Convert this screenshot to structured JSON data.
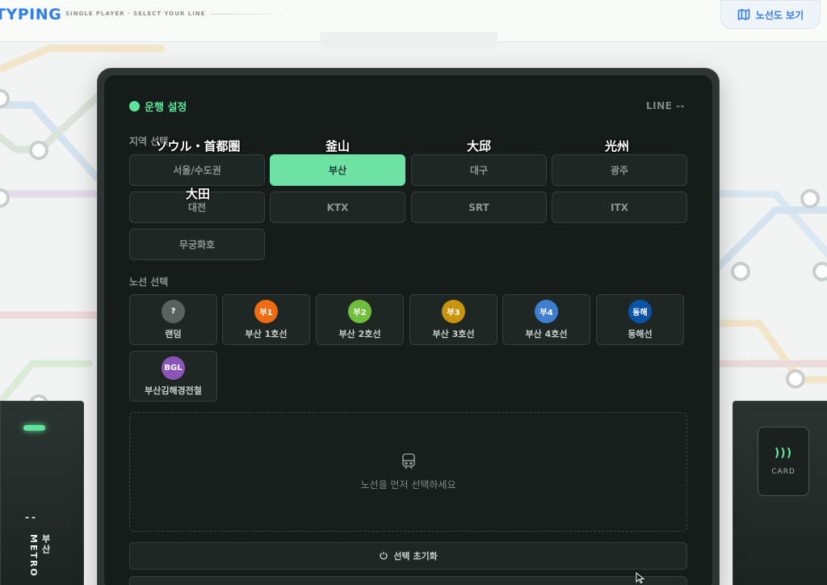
{
  "header": {
    "brand": "TYPING",
    "subtitle": "SINGLE PLAYER · SELECT YOUR LINE",
    "map_button": {
      "label": "노선도 보기",
      "icon": "map-icon"
    }
  },
  "panel": {
    "title": "운행 설정",
    "line_indicator": "LINE --",
    "region_section_label": "지역 선택",
    "regions": [
      {
        "label": "서울/수도권",
        "overlay": "ソウル・首都圏",
        "active": false
      },
      {
        "label": "부산",
        "overlay": "釜山",
        "active": true
      },
      {
        "label": "대구",
        "overlay": "大邱",
        "active": false
      },
      {
        "label": "광주",
        "overlay": "光州",
        "active": false
      },
      {
        "label": "대전",
        "overlay": "大田",
        "active": false
      },
      {
        "label": "KTX",
        "overlay": "",
        "active": false
      },
      {
        "label": "SRT",
        "overlay": "",
        "active": false
      },
      {
        "label": "ITX",
        "overlay": "",
        "active": false
      },
      {
        "label": "무궁화호",
        "overlay": "",
        "active": false
      }
    ],
    "line_section_label": "노선 선택",
    "lines": [
      {
        "badge": "?",
        "name": "랜덤",
        "color": "#5a625f"
      },
      {
        "badge": "부1",
        "name": "부산 1호선",
        "color": "#f06a0f"
      },
      {
        "badge": "부2",
        "name": "부산 2호선",
        "color": "#6fbf3a"
      },
      {
        "badge": "부3",
        "name": "부산 3호선",
        "color": "#c9930c"
      },
      {
        "badge": "부4",
        "name": "부산 4호선",
        "color": "#3d7fd0"
      },
      {
        "badge": "동해",
        "name": "동해선",
        "color": "#0a53a8"
      },
      {
        "badge": "BGL",
        "name": "부산김해경전철",
        "color": "#8b55b8"
      }
    ],
    "empty_state": {
      "icon": "train-icon",
      "text": "노선을 먼저 선택하세요"
    },
    "reset_button": {
      "label": "선택 초기화",
      "icon": "refresh-icon"
    }
  },
  "kiosk_left": {
    "dash": "--",
    "text": "부산 METRO"
  },
  "kiosk_right": {
    "card_label": "CARD",
    "waves": ")))"
  },
  "colors": {
    "accent": "#5fe39a",
    "brand": "#2f7df0",
    "panel_bg": "#161c1a"
  }
}
